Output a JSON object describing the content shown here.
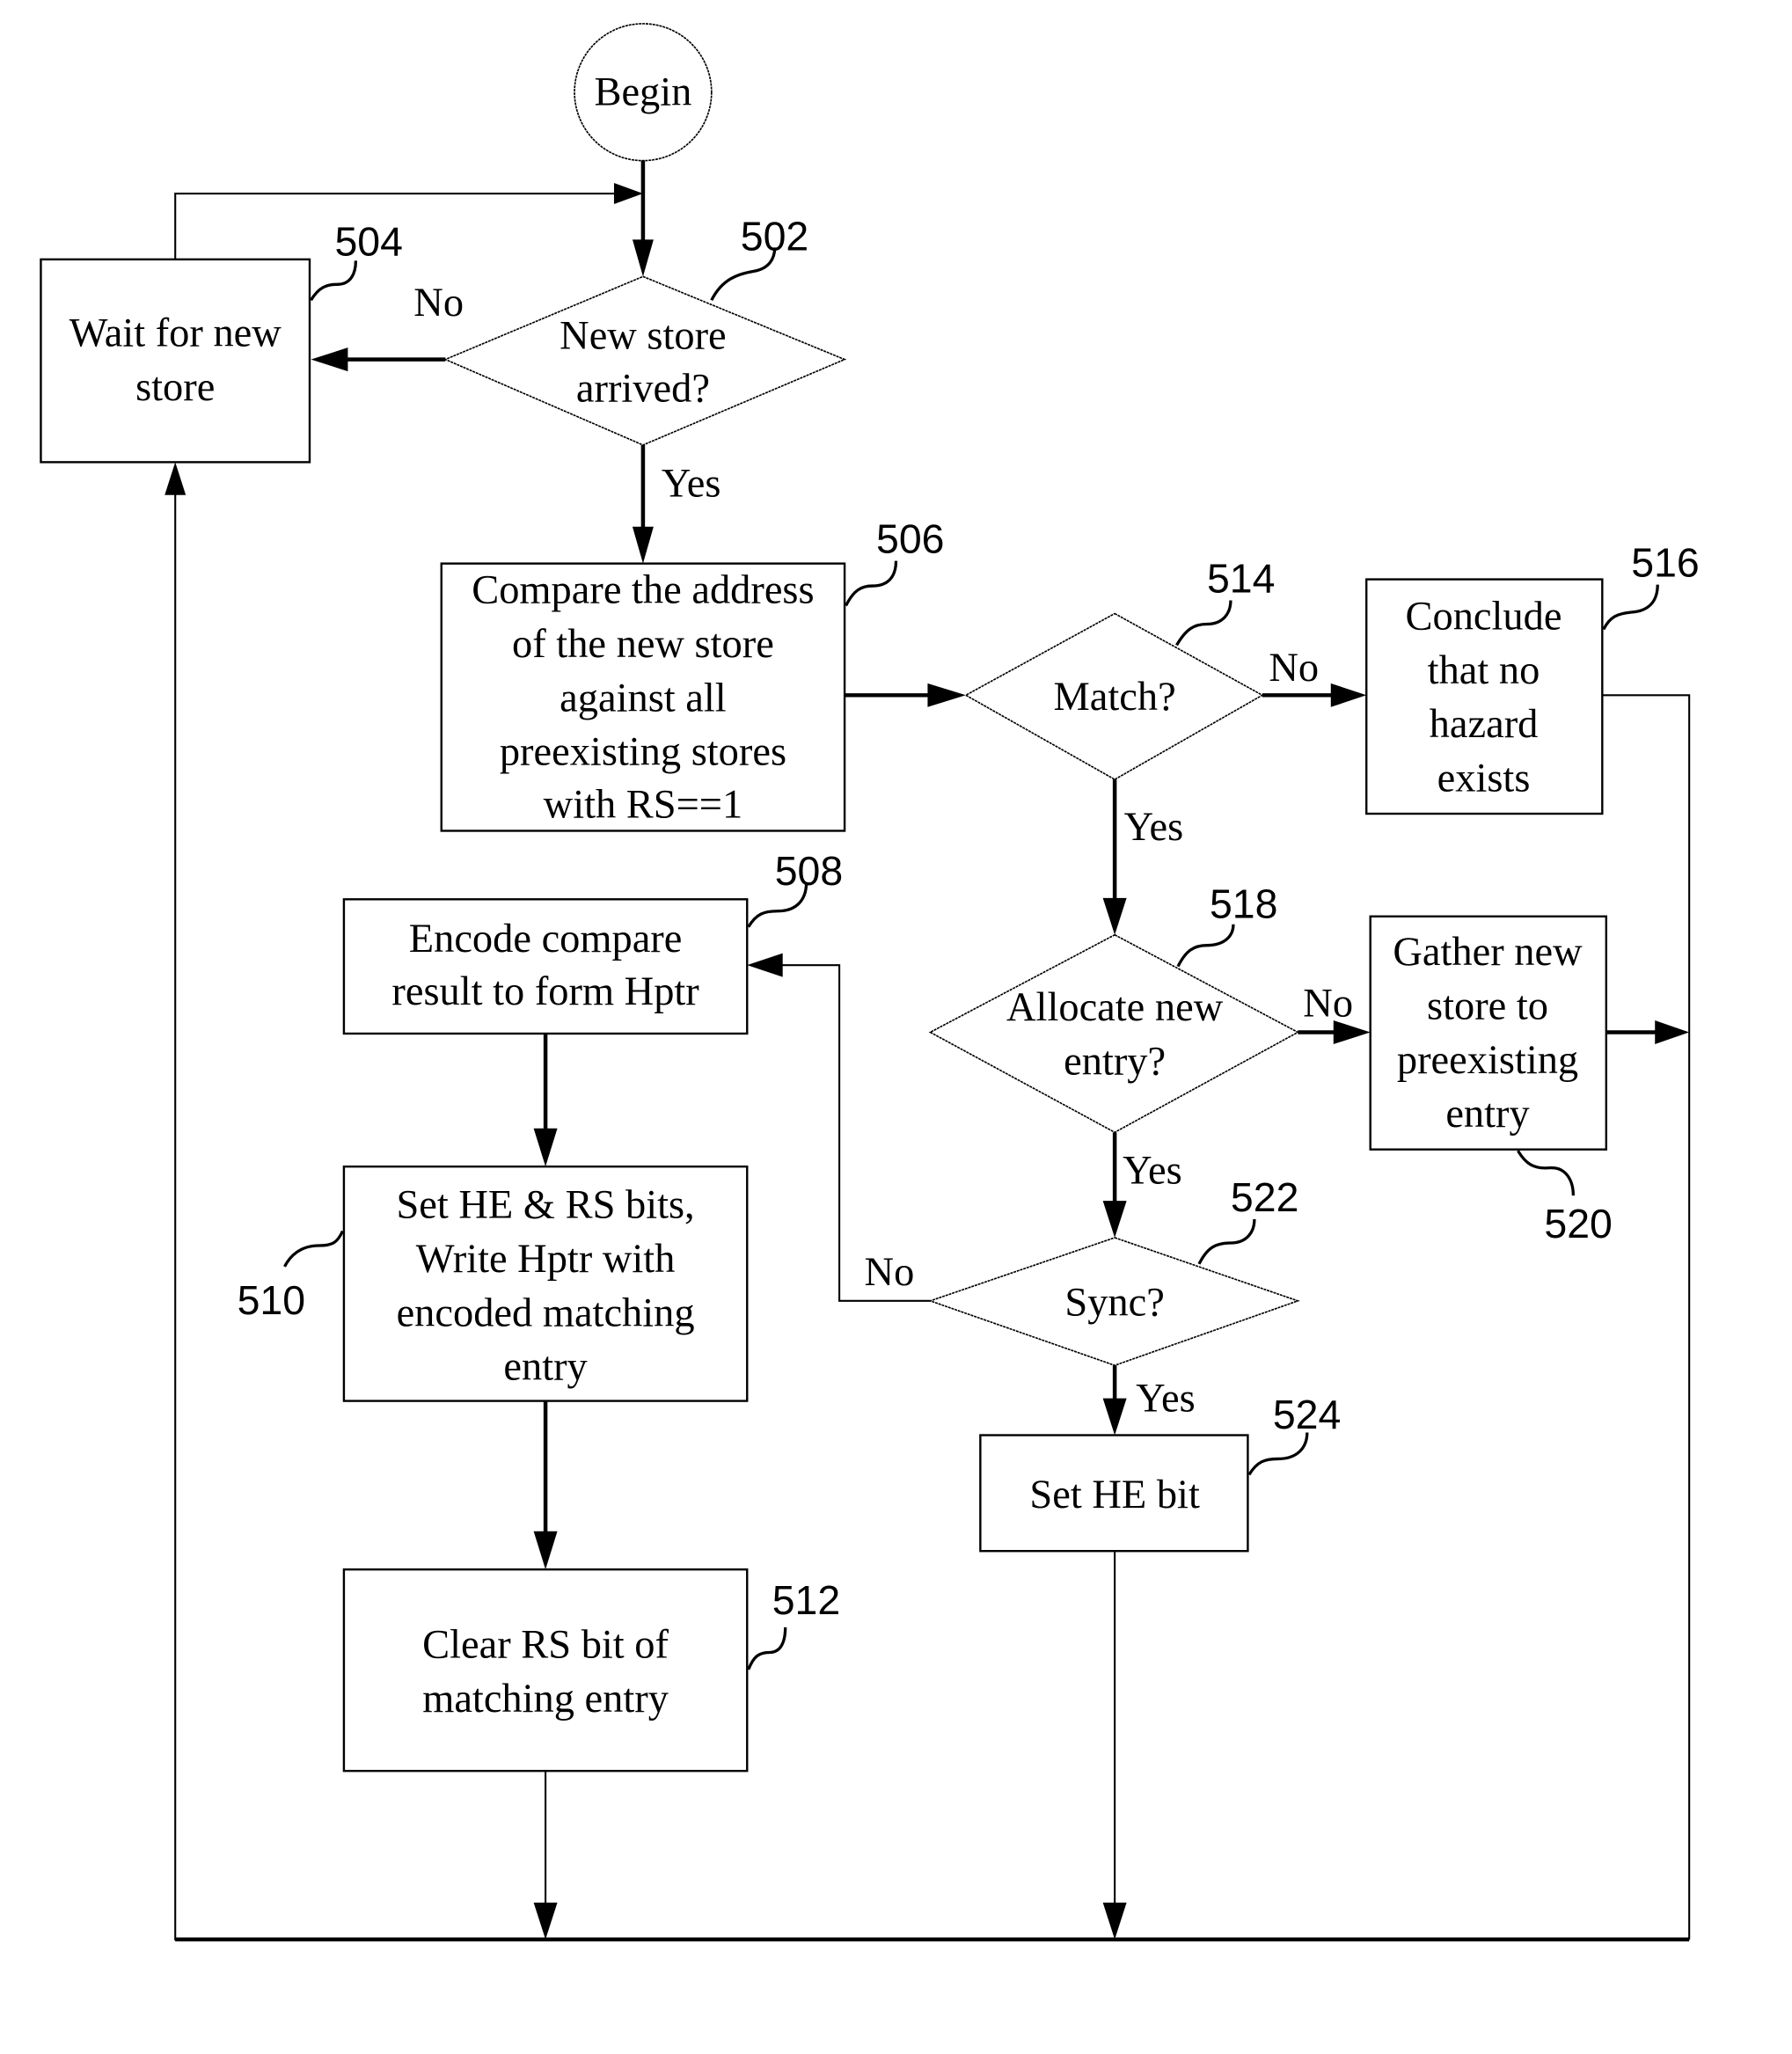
{
  "diagram": {
    "start": {
      "label": "Begin"
    },
    "nodes": {
      "n502": {
        "ref": "502",
        "type": "decision",
        "lines": [
          "New store",
          "arrived?"
        ]
      },
      "n504": {
        "ref": "504",
        "type": "process",
        "lines": [
          "Wait for new",
          "store"
        ]
      },
      "n506": {
        "ref": "506",
        "type": "process",
        "lines": [
          "Compare the address",
          "of the new store",
          "against all",
          "preexisting stores",
          "with RS==1"
        ]
      },
      "n508": {
        "ref": "508",
        "type": "process",
        "lines": [
          "Encode compare",
          "result to form Hptr"
        ]
      },
      "n510": {
        "ref": "510",
        "type": "process",
        "lines": [
          "Set HE & RS bits,",
          "Write Hptr with",
          "encoded matching",
          "entry"
        ]
      },
      "n512": {
        "ref": "512",
        "type": "process",
        "lines": [
          "Clear RS bit of",
          "matching entry"
        ]
      },
      "n514": {
        "ref": "514",
        "type": "decision",
        "lines": [
          "Match?"
        ]
      },
      "n516": {
        "ref": "516",
        "type": "process",
        "lines": [
          "Conclude",
          "that no",
          "hazard",
          "exists"
        ]
      },
      "n518": {
        "ref": "518",
        "type": "decision",
        "lines": [
          "Allocate new",
          "entry?"
        ]
      },
      "n520": {
        "ref": "520",
        "type": "process",
        "lines": [
          "Gather new",
          "store to",
          "preexisting",
          "entry"
        ]
      },
      "n522": {
        "ref": "522",
        "type": "decision",
        "lines": [
          "Sync?"
        ]
      },
      "n524": {
        "ref": "524",
        "type": "process",
        "lines": [
          "Set HE bit"
        ]
      }
    },
    "edge_labels": {
      "e502_no": "No",
      "e502_yes": "Yes",
      "e514_no": "No",
      "e514_yes": "Yes",
      "e518_no": "No",
      "e518_yes": "Yes",
      "e522_no": "No",
      "e522_yes": "Yes"
    },
    "edges": [
      {
        "from": "Begin",
        "to": "502"
      },
      {
        "from": "502",
        "to": "504",
        "label": "No"
      },
      {
        "from": "504",
        "to": "502"
      },
      {
        "from": "502",
        "to": "506",
        "label": "Yes"
      },
      {
        "from": "506",
        "to": "514"
      },
      {
        "from": "514",
        "to": "516",
        "label": "No"
      },
      {
        "from": "514",
        "to": "518",
        "label": "Yes"
      },
      {
        "from": "518",
        "to": "520",
        "label": "No"
      },
      {
        "from": "518",
        "to": "522",
        "label": "Yes"
      },
      {
        "from": "522",
        "to": "508",
        "label": "No"
      },
      {
        "from": "522",
        "to": "524",
        "label": "Yes"
      },
      {
        "from": "508",
        "to": "510"
      },
      {
        "from": "510",
        "to": "512"
      },
      {
        "from": "512",
        "to": "504"
      },
      {
        "from": "524",
        "to": "504"
      },
      {
        "from": "516",
        "to": "504"
      },
      {
        "from": "520",
        "to": "504"
      }
    ]
  }
}
